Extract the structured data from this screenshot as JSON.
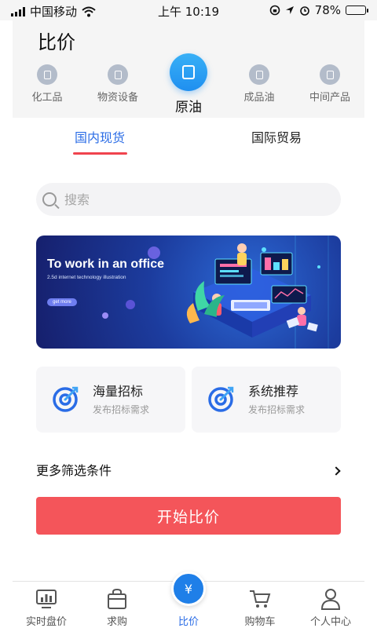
{
  "status_bar": {
    "carrier": "中国移动",
    "time": "上午 10:19",
    "battery": "78%",
    "battery_level": 0.78
  },
  "page": {
    "title": "比价"
  },
  "categories": [
    {
      "label": "化工品",
      "icon": "flask-icon"
    },
    {
      "label": "物资设备",
      "icon": "equipment-icon"
    },
    {
      "label": "原油",
      "icon": "oil-barrel-icon",
      "active": true
    },
    {
      "label": "成品油",
      "icon": "fuel-icon"
    },
    {
      "label": "中间产品",
      "icon": "box-icon"
    }
  ],
  "tabs": [
    {
      "label": "国内现货",
      "active": true
    },
    {
      "label": "国际贸易"
    }
  ],
  "search": {
    "placeholder": "搜索"
  },
  "banner": {
    "title": "To work in an office",
    "subtitle": "2.5d  internet technology illustration",
    "button": "get more"
  },
  "cards": [
    {
      "title": "海量招标",
      "subtitle": "发布招标需求",
      "icon": "target-icon"
    },
    {
      "title": "系统推荐",
      "subtitle": "发布招标需求",
      "icon": "target-icon"
    }
  ],
  "filters": {
    "label": "更多筛选条件"
  },
  "start_button": {
    "label": "开始比价"
  },
  "bottom_nav": [
    {
      "label": "实时盘价",
      "icon": "chart-monitor-icon"
    },
    {
      "label": "求购",
      "icon": "shopping-bag-icon"
    },
    {
      "label": "比价",
      "icon": "yen-card-icon",
      "active": true,
      "glyph": "¥"
    },
    {
      "label": "购物车",
      "icon": "cart-icon"
    },
    {
      "label": "个人中心",
      "icon": "user-icon"
    }
  ],
  "colors": {
    "accent_blue": "#2a6ce6",
    "accent_red": "#f0444e",
    "button_red": "#f4555a",
    "active_icon_blue": "#1f8ff0"
  }
}
